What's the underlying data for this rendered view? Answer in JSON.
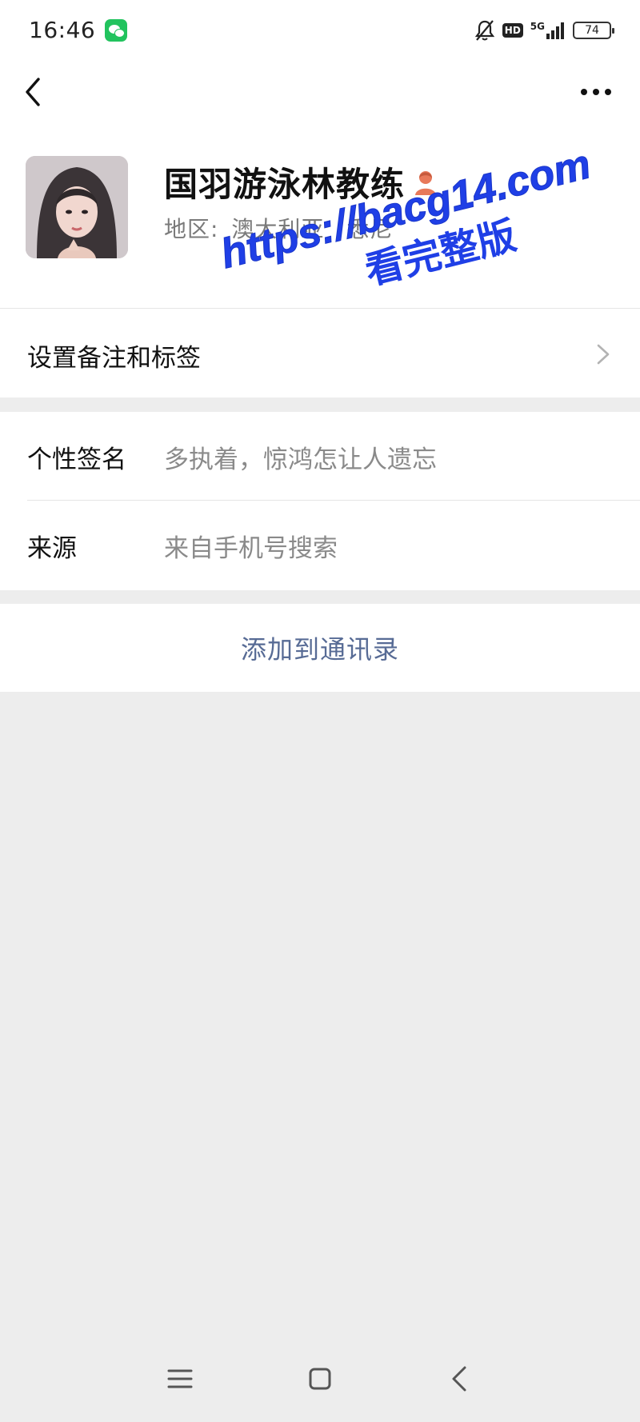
{
  "status_bar": {
    "time": "16:46",
    "network": "5G",
    "hd_label": "HD",
    "battery": "74",
    "icons": [
      "wechat-notification-icon",
      "bell-muted-icon",
      "hd-icon",
      "signal-icon",
      "battery-icon"
    ]
  },
  "nav": {
    "back_icon": "chevron-left-icon",
    "more_icon": "more-horizontal-icon"
  },
  "profile": {
    "name": "国羽游泳林教练",
    "region_label": "地区:",
    "region_country": "澳大利亚",
    "region_city": "悉尼",
    "gender_icon": "person-female-icon"
  },
  "remark": {
    "label": "设置备注和标签"
  },
  "info": {
    "signature_label": "个性签名",
    "signature_value": "多执着，惊鸿怎让人遗忘",
    "source_label": "来源",
    "source_value": "来自手机号搜索"
  },
  "actions": {
    "add_contact": "添加到通讯录"
  },
  "watermark": {
    "line1": "https://bacg14.com",
    "line2": "看完整版"
  },
  "colors": {
    "link_blue": "#576b95",
    "background": "#ededed",
    "watermark_blue": "#1f3fe6",
    "gender_icon": "#e8795a"
  }
}
